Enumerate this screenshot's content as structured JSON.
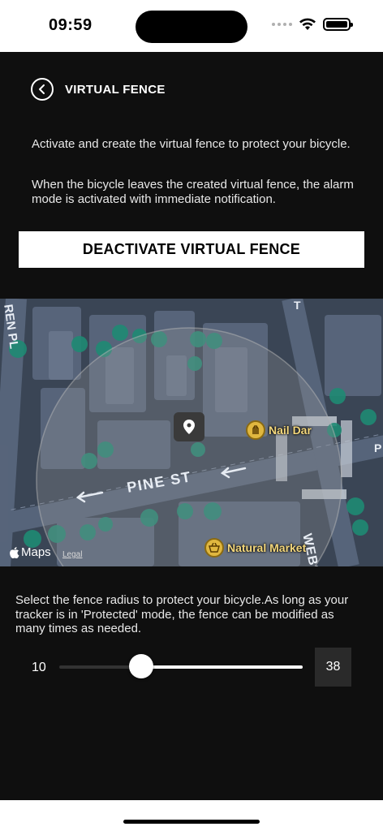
{
  "status_bar": {
    "time": "09:59"
  },
  "header": {
    "title": "VIRTUAL FENCE"
  },
  "intro": {
    "line1": "Activate and create the virtual fence to protect your bicycle.",
    "line2": "When the bicycle leaves the created virtual fence, the alarm mode is activated with immediate notification."
  },
  "fence_button": {
    "label": "DEACTIVATE VIRTUAL FENCE"
  },
  "map": {
    "streets": {
      "pine": "PINE ST",
      "webster": "WEBS",
      "left": "REN PL",
      "top_right": "T",
      "right_edge": "P"
    },
    "pois": {
      "nail": "Nail Dar",
      "market": "Natural Market"
    },
    "attribution": {
      "brand": "Maps",
      "legal": "Legal"
    }
  },
  "radius": {
    "description": "Select the fence radius to protect your bicycle.As long as your tracker is in 'Protected' mode, the fence can be modified as many times as needed.",
    "min_label": "10",
    "current_value": "38",
    "fraction": 0.34
  },
  "colors": {
    "background": "#0f0f0f",
    "accent": "#ffffff",
    "poi": "#e0b73f"
  },
  "icons": [
    "back-chevron-icon",
    "wifi-icon",
    "battery-icon",
    "location-pin-icon",
    "salon-icon",
    "basket-icon",
    "apple-icon"
  ]
}
